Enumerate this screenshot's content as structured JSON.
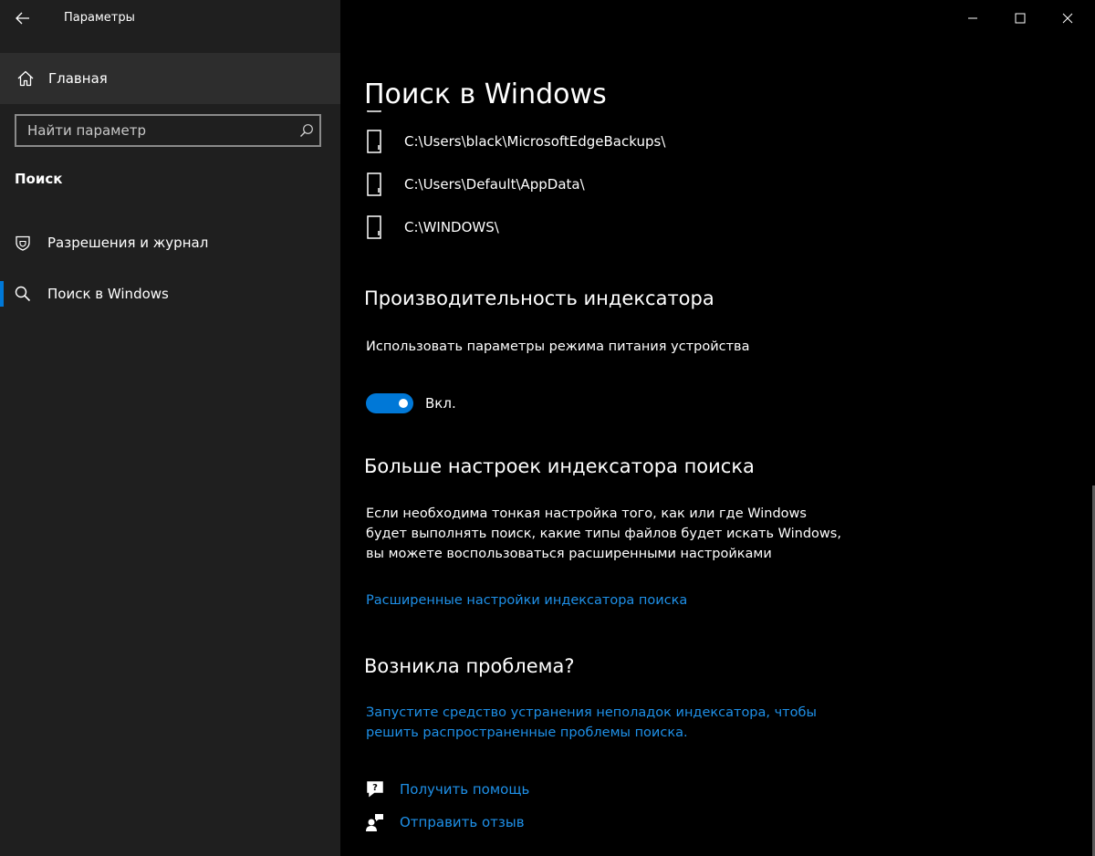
{
  "titlebar": {
    "title": "Параметры",
    "back_icon": "back-arrow-icon",
    "minimize_icon": "minimize-icon",
    "maximize_icon": "maximize-icon",
    "close_icon": "close-icon"
  },
  "sidebar": {
    "home": {
      "label": "Главная",
      "icon": "home-icon"
    },
    "search": {
      "placeholder": "Найти параметр",
      "icon": "search-icon"
    },
    "section": "Поиск",
    "items": [
      {
        "label": "Разрешения и журнал",
        "icon": "shield-icon",
        "active": false
      },
      {
        "label": "Поиск в Windows",
        "icon": "search-icon",
        "active": true
      }
    ]
  },
  "main": {
    "title": "Поиск в Windows",
    "excluded_folders": [
      "C:\\Users\\black\\MicrosoftEdgeBackups\\",
      "C:\\Users\\Default\\AppData\\",
      "C:\\WINDOWS\\"
    ],
    "indexer_performance": {
      "heading": "Производительность индексатора",
      "description": "Использовать параметры режима питания устройства",
      "toggle_on": true,
      "toggle_state": "Вкл."
    },
    "more_settings": {
      "heading": "Больше настроек индексатора поиска",
      "description": "Если необходима тонкая настройка того, как или где Windows будет выполнять поиск, какие типы файлов будет искать Windows, вы можете воспользоваться расширенными настройками",
      "link": "Расширенные настройки индексатора поиска"
    },
    "problem": {
      "heading": "Возникла проблема?",
      "link": "Запустите средство устранения неполадок индексатора, чтобы решить распространенные проблемы поиска."
    },
    "help": {
      "get_help": "Получить помощь",
      "feedback": "Отправить отзыв"
    }
  },
  "colors": {
    "accent": "#0078d7",
    "link": "#1e90e8",
    "sidebar_bg": "#1f1f1f",
    "main_bg": "#000000"
  }
}
